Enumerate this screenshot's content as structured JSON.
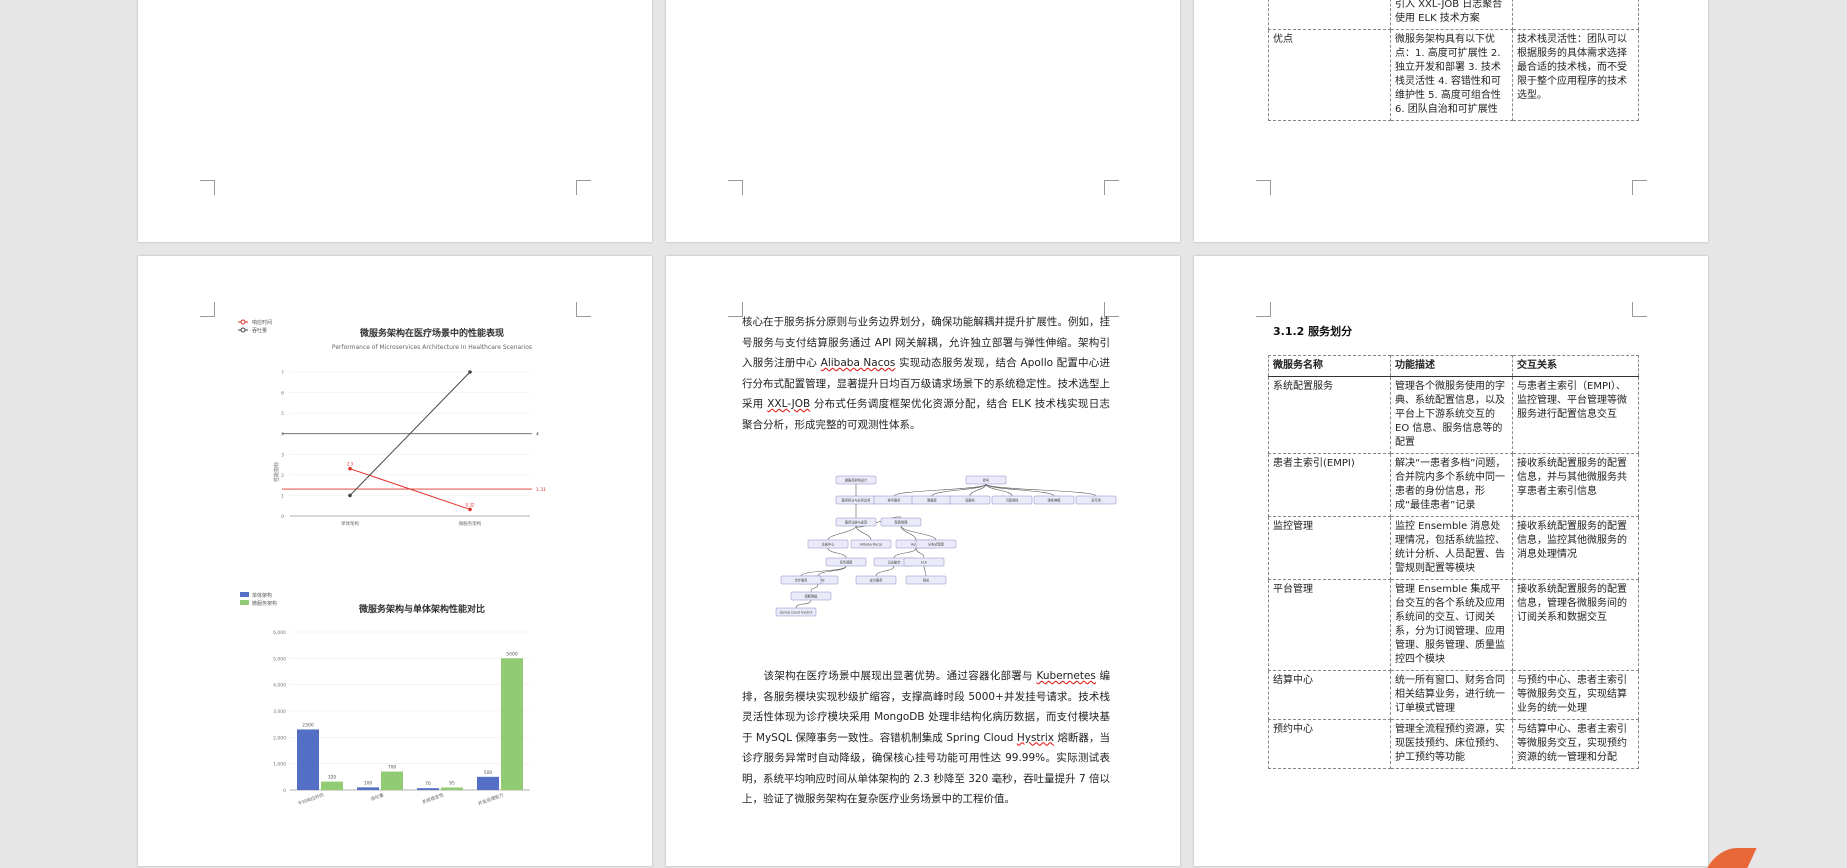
{
  "top_right_table": {
    "fragment_line1": "引入 XXL-JOB 日志聚合",
    "fragment_line2": "使用 ELK 技术方案",
    "row_label": "优点",
    "row_desc": "微服务架构具有以下优点：1. 高度可扩展性 2. 独立开发和部署 3. 技术栈灵活性 4. 容错性和可维护性 5. 高度可组合性 6. 团队自治和可扩展性",
    "row_rel": "技术栈灵活性：团队可以根据服务的具体需求选择最合适的技术栈，而不受限于整个应用程序的技术选型。"
  },
  "line_chart": {
    "legend": [
      "响应时间",
      "吞吐量"
    ],
    "title": "微服务架构在医疗场景中的性能表现",
    "subtitle": "Performance of Microservices Architecture in Healthcare Scenarios",
    "y_axis_label": "性能指标"
  },
  "bar_chart": {
    "legend": [
      "单体架构",
      "微服务架构"
    ],
    "title": "微服务架构与单体架构性能对比"
  },
  "chart_data": [
    {
      "type": "line",
      "title": "微服务架构在医疗场景中的性能表现",
      "subtitle": "Performance of Microservices Architecture in Healthcare Scenarios",
      "ylabel": "性能指标",
      "categories": [
        "单体架构",
        "微服务架构"
      ],
      "ylim": [
        0,
        7
      ],
      "yticks": [
        0,
        1,
        2,
        3,
        4,
        5,
        6,
        7
      ],
      "series": [
        {
          "name": "响应时间",
          "color": "#e0302a",
          "values": [
            2.3,
            0.32
          ]
        },
        {
          "name": "吞吐量",
          "color": "#444444",
          "values": [
            1,
            7
          ]
        }
      ],
      "point_labels": [
        "2.3",
        "0.32"
      ],
      "reference_lines": [
        {
          "value": 4,
          "label": "4",
          "color": "#444444"
        },
        {
          "value": 1.31,
          "label": "1.31",
          "color": "#e0302a"
        }
      ]
    },
    {
      "type": "bar",
      "title": "微服务架构与单体架构性能对比",
      "categories": [
        "平均响应时间",
        "吞吐量",
        "系统稳定性",
        "并发处理能力"
      ],
      "ylim": [
        0,
        6000
      ],
      "yticks": [
        0,
        1000,
        2000,
        3000,
        4000,
        5000,
        6000
      ],
      "series": [
        {
          "name": "单体架构",
          "color": "#5470c6",
          "values": [
            2300,
            100,
            70,
            500
          ]
        },
        {
          "name": "微服务架构",
          "color": "#91cc75",
          "values": [
            320,
            700,
            95,
            5000
          ]
        }
      ]
    }
  ],
  "middle_page": {
    "para1_parts": [
      {
        "t": "核心在于服务拆分原则与业务边界划分，确保功能解耦并提升扩展性。例如，挂号服务与支付结算服务通过 API 网关解耦，允许独立部署与弹性伸缩。架构引入服务注册中心 "
      },
      {
        "t": "Alibaba Nacos",
        "u": true
      },
      {
        "t": " 实现动态服务发现，结合 Apollo 配置中心进行分布式配置管理，显著提升日均百万级请求场景下的系统稳定性。技术选型上采用 "
      },
      {
        "t": "XXL-JOB",
        "u": true
      },
      {
        "t": " 分布式任务调度框架优化资源分配，结合 ELK 技术栈实现日志聚合分析，形成完整的可观测性体系。"
      }
    ],
    "para2_parts": [
      {
        "t": "　　该架构在医疗场景中展现出显著优势。通过容器化部署与 "
      },
      {
        "t": "Kubernetes",
        "u": true
      },
      {
        "t": " 编排，各服务模块实现秒级扩缩容，支撑高峰时段 5000+并发挂号请求。技术栈灵活性体现为诊疗模块采用 MongoDB 处理非结构化病历数据，而支付模块基于 MySQL 保障事务一致性。容错机制集成 Spring Cloud "
      },
      {
        "t": "Hystrix",
        "u": true
      },
      {
        "t": " 熔断器，当诊疗服务异常时自动降级，确保核心挂号功能可用性达 99.99%。实际测试表明，系统平均响应时间从单体架构的 2.3 秒降至 320 毫秒，吞吐量提升 7 倍以上，验证了微服务架构在复杂医疗业务场景中的工程价值。"
      }
    ],
    "diagram_nodes": [
      "微服务架构设计",
      "服务拆分与业务边界",
      "挂号",
      "服务注册与发现",
      "配置管理",
      "注册中心",
      "Alibaba Nacos",
      "Apollo",
      "分布式配置",
      "日志聚合",
      "ELK",
      "任务调度",
      "XXL-JOB",
      "网关",
      "Spring Cloud Hystrix",
      "熔断降级",
      "诊疗服务",
      "支付服务",
      "挂号服务",
      "数据库",
      "容器化",
      "可观测性",
      "弹性伸缩",
      "高可用"
    ]
  },
  "right_page": {
    "heading": "3.1.2 服务划分",
    "headers": [
      "微服务名称",
      "功能描述",
      "交互关系"
    ],
    "rows": [
      [
        "系统配置服务",
        "管理各个微服务使用的字典、系统配置信息，以及平台上下游系统交互的 EO 信息、服务信息等的配置",
        "与患者主索引（EMPI）、监控管理、平台管理等微服务进行配置信息交互"
      ],
      [
        "患者主索引(EMPI)",
        "解决“一患者多档”问题，合并院内多个系统中同一患者的身份信息，形成“最佳患者”记录",
        "接收系统配置服务的配置信息，并与其他微服务共享患者主索引信息"
      ],
      [
        "监控管理",
        "监控 Ensemble 消息处理情况，包括系统监控、统计分析、人员配置、告警规则配置等模块",
        "接收系统配置服务的配置信息，监控其他微服务的消息处理情况"
      ],
      [
        "平台管理",
        "管理 Ensemble 集成平台交互的各个系统及应用系统间的交互、订阅关系，分为订阅管理、应用管理、服务管理、质量监控四个模块",
        "接收系统配置服务的配置信息，管理各微服务间的订阅关系和数据交互"
      ],
      [
        "结算中心",
        "统一所有窗口、财务合同相关结算业务，进行统一订单模式管理",
        "与预约中心、患者主索引等微服务交互，实现结算业务的统一处理"
      ],
      [
        "预约中心",
        "管理全流程预约资源，实现医技预约、床位预约、护工预约等功能",
        "与结算中心、患者主索引等微服务交互，实现预约资源的统一管理和分配"
      ]
    ]
  }
}
